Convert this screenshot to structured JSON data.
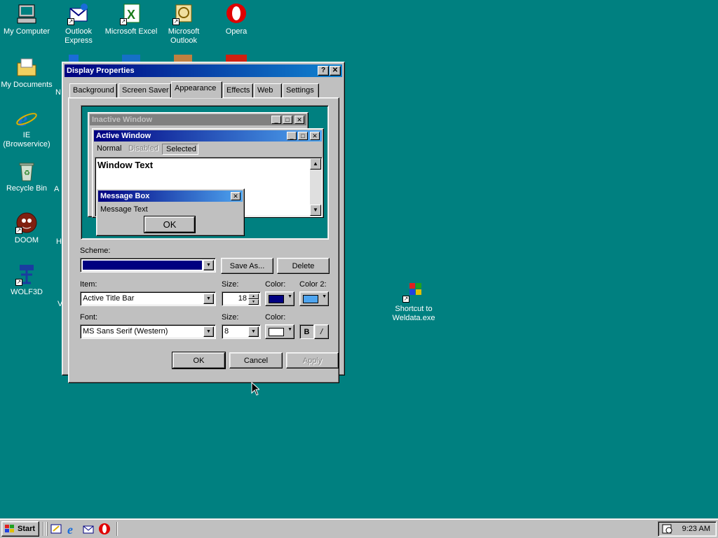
{
  "desktop": {
    "icons": [
      {
        "label": "My Computer",
        "icon": "my-computer-icon"
      },
      {
        "label": "Outlook Express",
        "icon": "outlook-express-icon"
      },
      {
        "label": "Microsoft Excel",
        "icon": "excel-icon"
      },
      {
        "label": "Microsoft Outlook",
        "icon": "outlook-icon"
      },
      {
        "label": "Opera",
        "icon": "opera-icon"
      },
      {
        "label": "My Documents",
        "icon": "my-documents-icon"
      },
      {
        "label": "IE (Browservice)",
        "icon": "ie-icon"
      },
      {
        "label": "Recycle Bin",
        "icon": "recycle-bin-icon"
      },
      {
        "label": "DOOM",
        "icon": "doom-icon"
      },
      {
        "label": "WOLF3D",
        "icon": "wolf3d-icon"
      },
      {
        "label": "Shortcut to Weldata.exe",
        "icon": "windows-shortcut-icon"
      }
    ],
    "partial_labels": [
      "N",
      "A",
      "H",
      "V"
    ]
  },
  "dialog": {
    "title": "Display Properties",
    "help_btn": "?",
    "close_btn": "✕",
    "tabs": [
      {
        "label": "Background",
        "active": false
      },
      {
        "label": "Screen Saver",
        "active": false
      },
      {
        "label": "Appearance",
        "active": true
      },
      {
        "label": "Effects",
        "active": false
      },
      {
        "label": "Web",
        "active": false
      },
      {
        "label": "Settings",
        "active": false
      }
    ],
    "preview": {
      "inactive_title": "Inactive Window",
      "active_title": "Active Window",
      "menu": [
        "Normal",
        "Disabled",
        "Selected"
      ],
      "window_text": "Window Text",
      "message_box_title": "Message Box",
      "message_text": "Message Text",
      "ok": "OK"
    },
    "scheme": {
      "label": "Scheme:",
      "value": "",
      "save_as": "Save As...",
      "delete": "Delete"
    },
    "item": {
      "label": "Item:",
      "value": "Active Title Bar",
      "size_label": "Size:",
      "size_value": "18",
      "color_label": "Color:",
      "color": "#000080",
      "color2_label": "Color 2:",
      "color2": "#4ea5f0"
    },
    "font": {
      "label": "Font:",
      "value": "MS Sans Serif (Western)",
      "size_label": "Size:",
      "size_value": "8",
      "color_label": "Color:",
      "color": "#ffffff",
      "bold": "B",
      "italic": "/"
    },
    "buttons": {
      "ok": "OK",
      "cancel": "Cancel",
      "apply": "Apply"
    }
  },
  "taskbar": {
    "start": "Start",
    "quicklaunch": [
      "show-desktop-icon",
      "ie-icon",
      "outlook-express-icon",
      "opera-icon"
    ],
    "clock": "9:23 AM"
  },
  "colors": {
    "desktop": "#008080",
    "title_active": "#000080",
    "face": "#c0c0c0"
  }
}
